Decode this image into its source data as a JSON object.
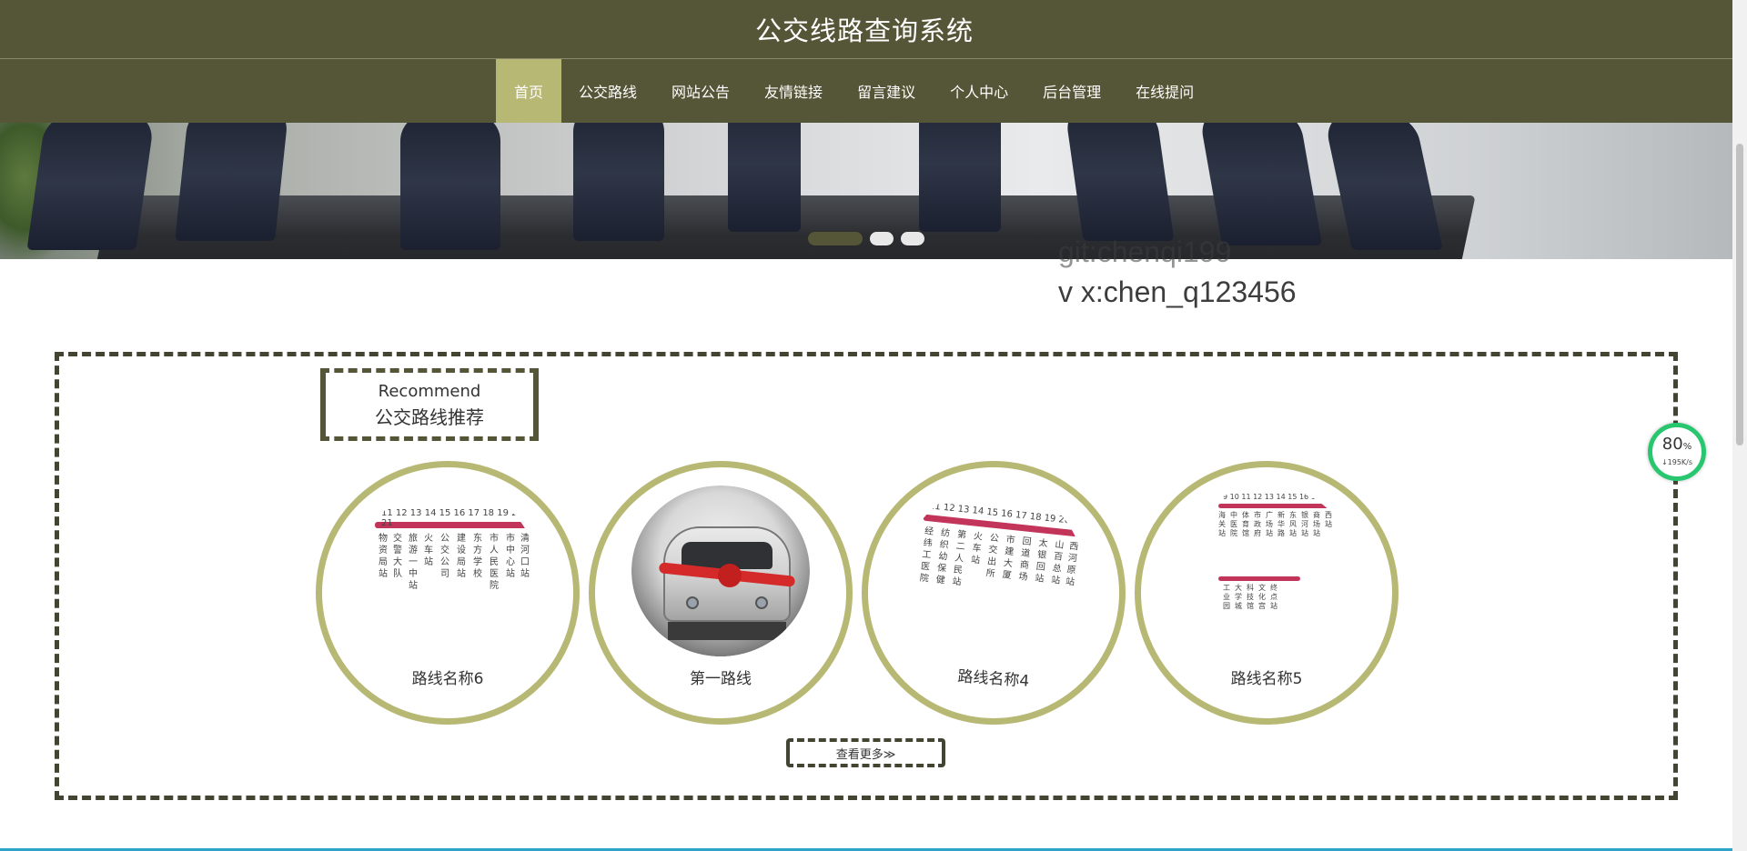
{
  "header": {
    "title": "公交线路查询系统"
  },
  "nav": {
    "items": [
      {
        "label": "首页",
        "active": true
      },
      {
        "label": "公交路线",
        "active": false
      },
      {
        "label": "网站公告",
        "active": false
      },
      {
        "label": "友情链接",
        "active": false
      },
      {
        "label": "留言建议",
        "active": false
      },
      {
        "label": "个人中心",
        "active": false
      },
      {
        "label": "后台管理",
        "active": false
      },
      {
        "label": "在线提问",
        "active": false
      }
    ]
  },
  "banner": {
    "slide_count": 3,
    "active_slide": 1
  },
  "watermark": {
    "line1": "git:chenqi199",
    "line2": "v x:chen_q123456"
  },
  "recommend": {
    "title_en": "Recommend",
    "title_zh": "公交路线推荐",
    "cards": [
      {
        "name": "路线名称6",
        "image": "route-map-icon"
      },
      {
        "name": "第一路线",
        "image": "train-icon"
      },
      {
        "name": "路线名称4",
        "image": "route-map-icon"
      },
      {
        "name": "路线名称5",
        "image": "route-map-icon"
      }
    ],
    "more_label": "查看更多≫"
  },
  "speed_widget": {
    "percent": "80",
    "percent_unit": "%",
    "rate": "↓195K/s"
  },
  "colors": {
    "header_bg": "#555537",
    "accent": "#b7b873",
    "route_line": "#c2345a"
  }
}
